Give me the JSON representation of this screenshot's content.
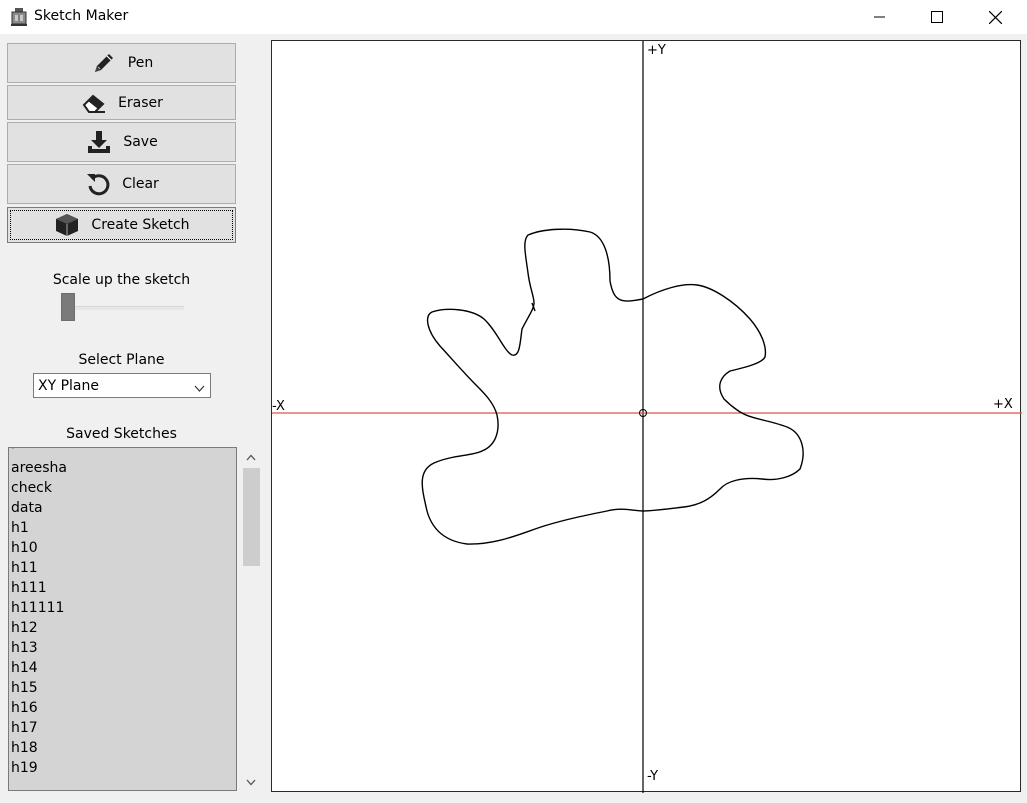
{
  "window": {
    "title": "Sketch Maker",
    "icon": "app-icon"
  },
  "toolbar": {
    "pen_label": "Pen",
    "eraser_label": "Eraser",
    "save_label": "Save",
    "clear_label": "Clear",
    "create_label": "Create Sketch"
  },
  "scale": {
    "label": "Scale up the sketch",
    "value": 0
  },
  "plane": {
    "label": "Select Plane",
    "selected": "XY Plane"
  },
  "saved": {
    "label": "Saved Sketches",
    "items": [
      "'",
      "areesha",
      "check",
      "data",
      "h1",
      "h10",
      "h11",
      "h111",
      "h11111",
      "h12",
      "h13",
      "h14",
      "h15",
      "h16",
      "h17",
      "h18",
      "h19"
    ]
  },
  "canvas": {
    "pos_y": "+Y",
    "neg_y": "-Y",
    "pos_x": "+X",
    "neg_x": "-X",
    "x_axis_color": "#d9534f",
    "y_axis_color": "#000000"
  }
}
